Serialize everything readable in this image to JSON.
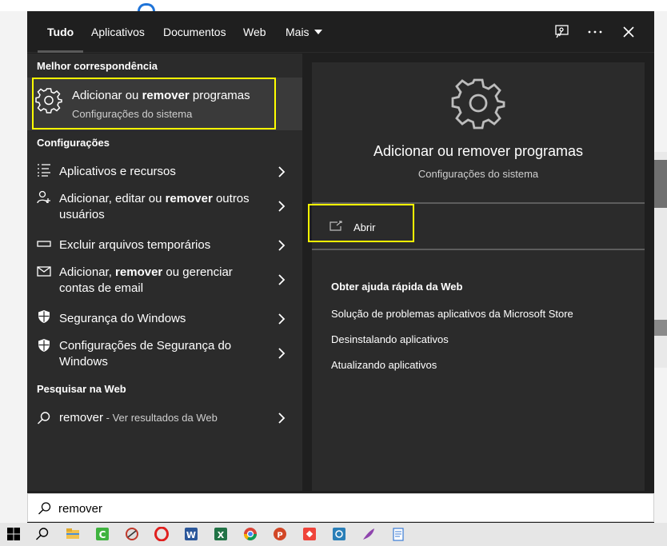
{
  "menu": {
    "tabs": [
      {
        "label": "Tudo",
        "active": true
      },
      {
        "label": "Aplicativos",
        "active": false
      },
      {
        "label": "Documentos",
        "active": false
      },
      {
        "label": "Web",
        "active": false
      },
      {
        "label": "Mais",
        "active": false
      }
    ],
    "top_icons": [
      "feedback-icon",
      "more-options-icon",
      "close-icon"
    ]
  },
  "left": {
    "best_match_header": "Melhor correspondência",
    "best_match": {
      "title_pre": "Adicionar ou ",
      "title_bold": "remover",
      "title_post": " programas",
      "subtitle": "Configurações do sistema",
      "icon": "gear-icon"
    },
    "settings_header": "Configurações",
    "settings_items": [
      {
        "pre": "Aplicativos e recursos",
        "bold": "",
        "post": "",
        "icon": "apps-list-icon"
      },
      {
        "pre": "Adicionar, editar ou ",
        "bold": "remover",
        "post": " outros usuários",
        "icon": "user-icon"
      },
      {
        "pre": "Excluir arquivos temporários",
        "bold": "",
        "post": "",
        "icon": "storage-icon"
      },
      {
        "pre": "Adicionar, ",
        "bold": "remover",
        "post": " ou gerenciar contas de email",
        "icon": "mail-icon"
      },
      {
        "pre": "Segurança do Windows",
        "bold": "",
        "post": "",
        "icon": "shield-icon"
      },
      {
        "pre": "Configurações de Segurança do Windows",
        "bold": "",
        "post": "",
        "icon": "shield-icon"
      }
    ],
    "web_header": "Pesquisar na Web",
    "web_item": {
      "query": "remover",
      "hint": " - Ver resultados da Web",
      "icon": "search-icon"
    }
  },
  "right": {
    "title": "Adicionar ou remover programas",
    "subtitle": "Configurações do sistema",
    "open_label": "Abrir",
    "help_title": "Obter ajuda rápida da Web",
    "help_links": [
      "Solução de problemas aplicativos da Microsoft Store",
      "Desinstalando aplicativos",
      "Atualizando aplicativos"
    ]
  },
  "search": {
    "value": "remover"
  },
  "taskbar": {
    "icons": [
      "windows-start-icon",
      "search-icon",
      "file-explorer-icon",
      "camtasia-icon",
      "snipping-tool-icon",
      "opera-icon",
      "word-icon",
      "excel-icon",
      "chrome-icon",
      "powerpoint-icon",
      "anydesk-icon",
      "app-icon",
      "feather-icon",
      "notepad-icon"
    ]
  },
  "colors": {
    "menu_bg": "#1f1f1f",
    "panel_bg": "#2b2b2b",
    "selected_bg": "#3a3a3a",
    "highlight": "#ffff00"
  }
}
